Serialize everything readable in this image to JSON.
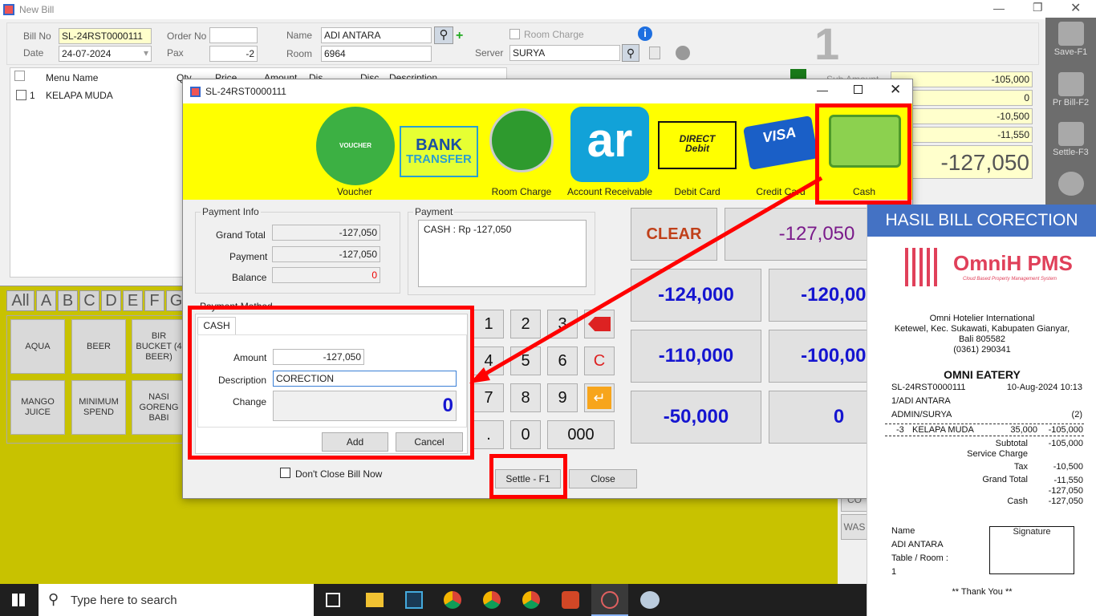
{
  "window": {
    "title": "New Bill",
    "bill_no_label": "Bill No",
    "bill_no": "SL-24RST0000111",
    "order_no_label": "Order No",
    "order_no": "",
    "name_label": "Name",
    "name": "ADI ANTARA",
    "room_charge_label": "Room Charge",
    "date_label": "Date",
    "date": "24-07-2024",
    "pax_label": "Pax",
    "pax": "-2",
    "room_label": "Room",
    "room": "6964",
    "server_label": "Server",
    "server": "SURYA",
    "big_number": "1"
  },
  "grid": {
    "headers": [
      "Menu Name",
      "Qty",
      "Price",
      "Amount",
      "Dis",
      "Disc",
      "Description"
    ],
    "rows": [
      {
        "no": "1",
        "menu": "KELAPA MUDA"
      }
    ]
  },
  "sidebar": {
    "save": "Save-F1",
    "print": "Pr Bill-F2",
    "settle": "Settle-F3"
  },
  "totals": {
    "sub_amount_label": "Sub Amount",
    "values": [
      "-105,000",
      "0",
      "-10,500",
      "-11,550"
    ],
    "grand": "-127,050"
  },
  "right_panel": {
    "btn_partial": "CO",
    "btn_wash": "WAS"
  },
  "category_tabs": [
    "All",
    "A",
    "B",
    "C",
    "D",
    "E",
    "F",
    "G"
  ],
  "menu_items": [
    "AQUA",
    "BEER",
    "BIR BUCKET (4 BEER)",
    "MANGO JUICE",
    "MINIMUM SPEND",
    "NASI GORENG BABI"
  ],
  "taskbar": {
    "search_placeholder": "Type here to search"
  },
  "dialog": {
    "title": "SL-24RST0000111",
    "methods": [
      {
        "label": "Voucher",
        "icon": "VOUCHER"
      },
      {
        "label": "",
        "icon_l1": "BANK",
        "icon_l2": "TRANSFER"
      },
      {
        "label": "Room Charge"
      },
      {
        "label": "Account Receivable",
        "icon": "ar"
      },
      {
        "label": "Debit Card",
        "icon_l1": "DIRECT",
        "icon_l2": "Debit"
      },
      {
        "label": "Credit Card",
        "icon": "VISA"
      },
      {
        "label": "Cash"
      }
    ],
    "payment_info": {
      "title": "Payment Info",
      "grand_total_label": "Grand Total",
      "grand_total": "-127,050",
      "payment_label": "Payment",
      "payment": "-127,050",
      "balance_label": "Balance",
      "balance": "0"
    },
    "payment": {
      "title": "Payment",
      "line": "CASH :  Rp -127,050"
    },
    "payment_method": {
      "title": "Payment Method",
      "tab": "CASH",
      "amount_label": "Amount",
      "amount": "-127,050",
      "description_label": "Description",
      "description": "CORECTION",
      "change_label": "Change",
      "change": "0",
      "add": "Add",
      "cancel": "Cancel"
    },
    "keypad": [
      "1",
      "2",
      "3",
      "4",
      "5",
      "6",
      "7",
      "8",
      "9",
      ".",
      "0",
      "000"
    ],
    "clear_key": "C",
    "clear_button": "CLEAR",
    "display": "-127,050",
    "quick": [
      "-124,000",
      "-120,000",
      "-110,000",
      "-100,000",
      "-50,000",
      "0"
    ],
    "dont_close": "Don't Close Bill Now",
    "settle": "Settle - F1",
    "close": "Close"
  },
  "receipt": {
    "header": "HASIL BILL CORECTION",
    "logo_text": "OmniH PMS",
    "logo_sub": "Cloud Based Property Management System",
    "company": "Omni Hotelier International",
    "address1": "Ketewel, Kec. Sukawati, Kabupaten Gianyar,",
    "address2": "Bali 805582",
    "phone": "(0361) 290341",
    "outlet": "OMNI EATERY",
    "bill_no": "SL-24RST0000111",
    "date": "10-Aug-2024 10:13",
    "guest": "1/ADI ANTARA",
    "staff": "ADMIN/SURYA",
    "pax": "(2)",
    "item_qty": "-3",
    "item_name": "KELAPA MUDA",
    "item_price": "35,000",
    "item_amount": "-105,000",
    "subtotal_label": "Subtotal",
    "subtotal": "-105,000",
    "service_label": "Service Charge",
    "service": "-10,500",
    "tax_label": "Tax",
    "tax": "-11,550",
    "grand_label": "Grand Total",
    "grand": "-127,050",
    "cash_label": "Cash",
    "cash": "-127,050",
    "name_label": "Name",
    "name": "ADI ANTARA",
    "table_label": "Table / Room :",
    "table": "1",
    "signature_label": "Signature",
    "thanks": "** Thank You **"
  },
  "colors": {
    "accent_red": "#ff0000",
    "yellow": "#ffff00",
    "receipt_header": "#4472c4",
    "quick_blue": "#1515d0"
  }
}
